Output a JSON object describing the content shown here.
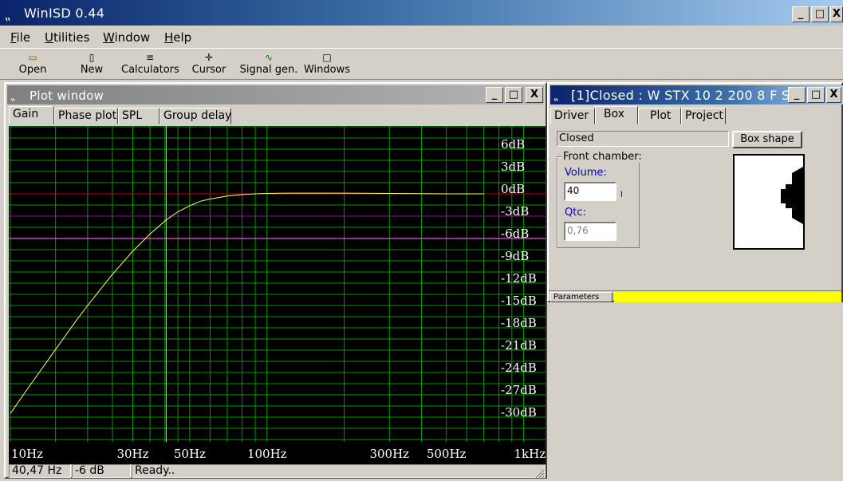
{
  "app": {
    "title": "WinISD 0.44"
  },
  "menu": [
    {
      "key": "F",
      "rest": "ile"
    },
    {
      "key": "U",
      "rest": "tilities"
    },
    {
      "key": "W",
      "rest": "indow"
    },
    {
      "key": "H",
      "rest": "elp"
    }
  ],
  "toolbar": [
    {
      "label": "Open",
      "icon": "open-folder-icon",
      "glyph": "▭"
    },
    {
      "label": "New",
      "icon": "new-document-icon",
      "glyph": "▯"
    },
    {
      "label": "Calculators",
      "icon": "calculator-icon",
      "glyph": "≡"
    },
    {
      "label": "Cursor",
      "icon": "cursor-icon",
      "glyph": "✛"
    },
    {
      "label": "Signal gen.",
      "icon": "signal-generator-icon",
      "glyph": "∿"
    },
    {
      "label": "Windows",
      "icon": "windows-icon",
      "glyph": "□"
    }
  ],
  "plot_window": {
    "title": "Plot window",
    "tabs": [
      "Gain",
      "Phase plot",
      "SPL",
      "Group delay"
    ],
    "active_tab": "Gain",
    "status": {
      "freq": "40,47 Hz",
      "gain": "-6 dB",
      "message": "Ready.."
    }
  },
  "box_window": {
    "title": "[1]Closed : W STX 10 2 200 8 F S",
    "tabs": [
      "Driver",
      "Box",
      "Plot",
      "Project"
    ],
    "active_tab": "Box",
    "box_type": "Closed",
    "box_shape_button": "Box shape",
    "front_chamber_label": "Front chamber:",
    "volume_label": "Volume:",
    "volume_value": "40",
    "volume_unit": "l",
    "qtc_label": "Qtc:",
    "qtc_value": "0,76",
    "parameters_tab": "Parameters"
  },
  "chart_data": {
    "type": "line",
    "title": "",
    "xlabel": "",
    "ylabel": "",
    "x_scale": "log",
    "xlim": [
      10,
      1200
    ],
    "ylim": [
      -31,
      8
    ],
    "x_tick_labels": [
      {
        "value": 10,
        "label": "10Hz"
      },
      {
        "value": 30,
        "label": "30Hz"
      },
      {
        "value": 50,
        "label": "50Hz"
      },
      {
        "value": 100,
        "label": "100Hz"
      },
      {
        "value": 300,
        "label": "300Hz"
      },
      {
        "value": 500,
        "label": "500Hz"
      },
      {
        "value": 1000,
        "label": "1kHz"
      }
    ],
    "y_tick_labels": [
      {
        "value": 6,
        "label": "6dB"
      },
      {
        "value": 3,
        "label": "3dB"
      },
      {
        "value": 0,
        "label": "0dB"
      },
      {
        "value": -3,
        "label": "-3dB"
      },
      {
        "value": -6,
        "label": "-6dB"
      },
      {
        "value": -9,
        "label": "-9dB"
      },
      {
        "value": -12,
        "label": "-12dB"
      },
      {
        "value": -15,
        "label": "-15dB"
      },
      {
        "value": -18,
        "label": "-18dB"
      },
      {
        "value": -21,
        "label": "-21dB"
      },
      {
        "value": -24,
        "label": "-24dB"
      },
      {
        "value": -27,
        "label": "-27dB"
      },
      {
        "value": -30,
        "label": "-30dB"
      }
    ],
    "series": [
      {
        "color": "#ffff66",
        "x": [
          10,
          12,
          15,
          18,
          20,
          25,
          30,
          35,
          40.47,
          45,
          50,
          55,
          60,
          70,
          80,
          90,
          100,
          120,
          150,
          200,
          300,
          500,
          700
        ],
        "y": [
          -29.5,
          -25.6,
          -20.9,
          -17.1,
          -15.0,
          -10.8,
          -7.7,
          -5.4,
          -3.5,
          -2.4,
          -1.6,
          -1.0,
          -0.7,
          -0.3,
          -0.1,
          0.0,
          0.05,
          0.1,
          0.1,
          0.1,
          0.05,
          0.0,
          0.0
        ]
      }
    ],
    "reference_lines": [
      {
        "value": 0,
        "color": "#c00000"
      },
      {
        "value": -3,
        "color": "#a000a0"
      },
      {
        "value": -6,
        "color": "#ff80ff"
      }
    ],
    "cursor": {
      "x": 40.47,
      "y": -6
    },
    "grid": true,
    "colors": {
      "background": "#000000",
      "grid": "#009900",
      "text": "#ffffff"
    }
  }
}
